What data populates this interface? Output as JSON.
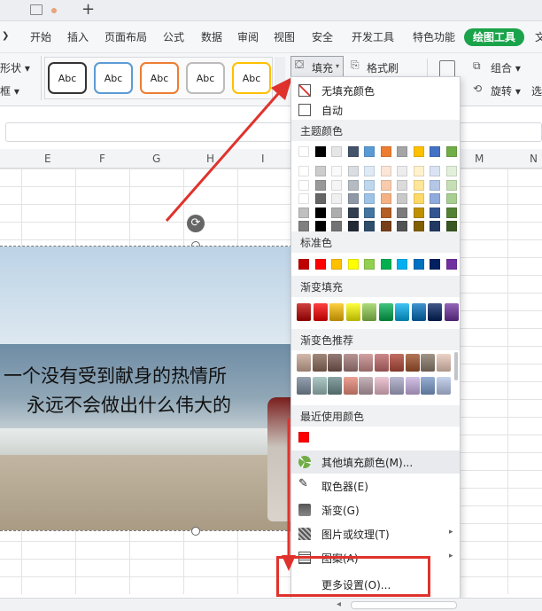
{
  "menu_tabs": [
    "开始",
    "插入",
    "页面布局",
    "公式",
    "数据",
    "审阅",
    "视图",
    "安全",
    "开发工具",
    "特色功能",
    "绘图工具",
    "文"
  ],
  "ribbon": {
    "left_items": [
      "形状",
      "框"
    ],
    "style_presets": [
      "Abc",
      "Abc",
      "Abc",
      "Abc",
      "Abc"
    ],
    "fill_label": "填充",
    "format_painter_label": "格式刷",
    "group_label": "组合",
    "rotate_label": "旋转",
    "select_label": "选"
  },
  "columns": [
    "E",
    "F",
    "G",
    "H",
    "I",
    "M",
    "N"
  ],
  "image_text": {
    "line1": "一个没有受到献身的热情所",
    "line2": "永远不会做出什么伟大的"
  },
  "fill_menu": {
    "no_fill": "无填充颜色",
    "auto": "自动",
    "theme_colors_title": "主题颜色",
    "standard_colors_title": "标准色",
    "gradient_fill_title": "渐变填充",
    "gradient_recommend_title": "渐变色推荐",
    "recent_colors_title": "最近使用颜色",
    "more_fill_colors": "其他填充颜色(M)...",
    "eyedropper": "取色器(E)",
    "gradient": "渐变(G)",
    "picture_texture": "图片或纹理(T)",
    "pattern": "图案(A)",
    "more_settings": "更多设置(O)...",
    "theme_top_row": [
      "#ffffff",
      "#000000",
      "#e7e6e6",
      "#44546a",
      "#5b9bd5",
      "#ed7d31",
      "#a5a5a5",
      "#ffc000",
      "#4472c4",
      "#70ad47"
    ],
    "standard_colors": [
      "#c00000",
      "#ff0000",
      "#ffc000",
      "#ffff00",
      "#92d050",
      "#00b050",
      "#00b0f0",
      "#0070c0",
      "#002060",
      "#7030a0"
    ],
    "recent_colors": [
      "#ff0000"
    ]
  }
}
